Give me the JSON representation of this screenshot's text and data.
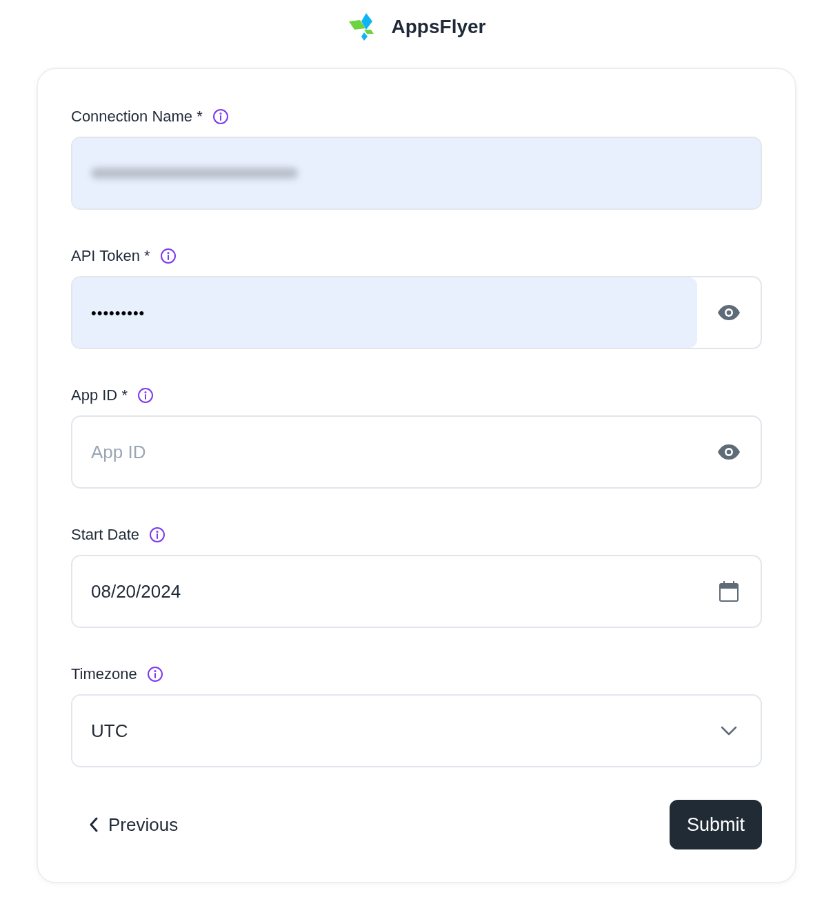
{
  "brand": {
    "name": "AppsFlyer"
  },
  "fields": [
    {
      "kind": "text",
      "label": "Connection Name",
      "required_mark": "*",
      "autofilled": true,
      "redacted": true,
      "toggle": false
    },
    {
      "kind": "password",
      "label": "API Token",
      "required_mark": "*",
      "autofilled": true,
      "value": "•••••••••",
      "toggle": true
    },
    {
      "kind": "password",
      "label": "App ID",
      "required_mark": "*",
      "autofilled": false,
      "placeholder": "App ID",
      "toggle": true
    },
    {
      "kind": "date",
      "label": "Start Date",
      "autofilled": false,
      "value": "08/20/2024",
      "toggle": false
    },
    {
      "kind": "select",
      "label": "Timezone",
      "autofilled": false,
      "value": "UTC",
      "toggle": false
    }
  ],
  "previous": "Previous",
  "submit": "Submit"
}
